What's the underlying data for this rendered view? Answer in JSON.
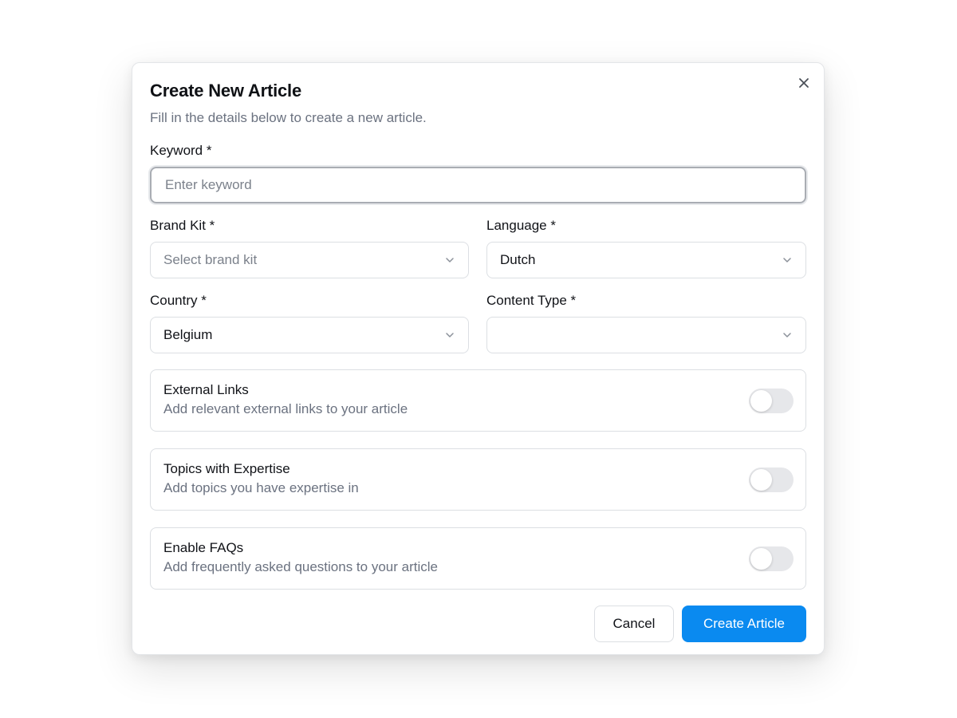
{
  "dialog": {
    "title": "Create New Article",
    "subtitle": "Fill in the details below to create a new article.",
    "close_icon": "close-icon"
  },
  "fields": {
    "keyword": {
      "label": "Keyword *",
      "placeholder": "Enter keyword",
      "value": ""
    },
    "brand_kit": {
      "label": "Brand Kit *",
      "placeholder": "Select brand kit",
      "value": ""
    },
    "language": {
      "label": "Language *",
      "value": "Dutch"
    },
    "country": {
      "label": "Country *",
      "value": "Belgium"
    },
    "content_type": {
      "label": "Content Type *",
      "value": ""
    }
  },
  "toggles": [
    {
      "title": "External Links",
      "description": "Add relevant external links to your article",
      "enabled": false
    },
    {
      "title": "Topics with Expertise",
      "description": "Add topics you have expertise in",
      "enabled": false
    },
    {
      "title": "Enable FAQs",
      "description": "Add frequently asked questions to your article",
      "enabled": false
    }
  ],
  "actions": {
    "cancel_label": "Cancel",
    "create_label": "Create Article"
  },
  "colors": {
    "primary": "#0a8af0",
    "toggle_off": "#e6e7ea",
    "muted_text": "#6b7280"
  }
}
